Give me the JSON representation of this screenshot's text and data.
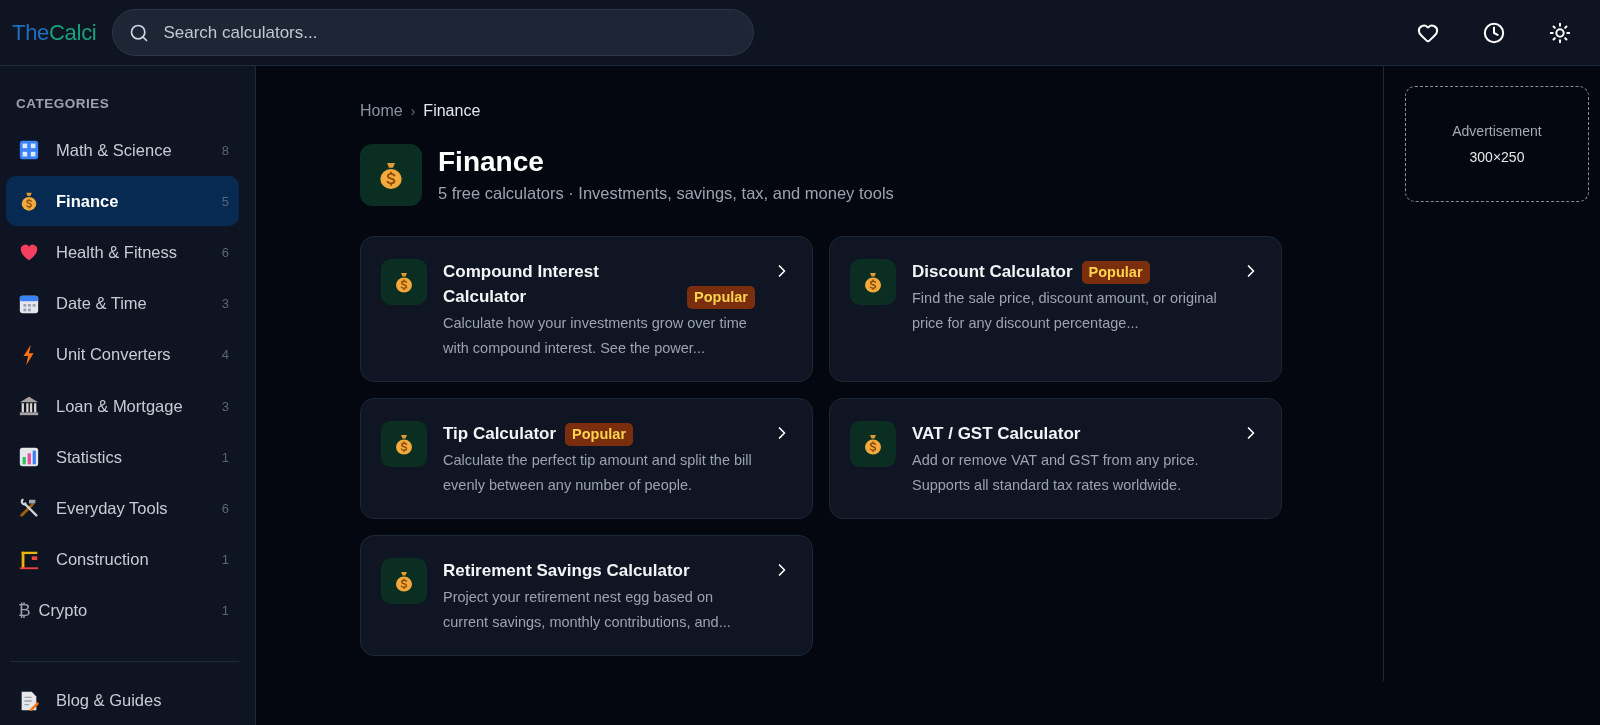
{
  "logo": {
    "first": "The",
    "second": "Calci"
  },
  "search": {
    "placeholder": "Search calculators..."
  },
  "sidebar": {
    "heading": "CATEGORIES",
    "items": [
      {
        "label": "Math & Science",
        "count": "8",
        "selected": false
      },
      {
        "label": "Finance",
        "count": "5",
        "selected": true
      },
      {
        "label": "Health & Fitness",
        "count": "6",
        "selected": false
      },
      {
        "label": "Date & Time",
        "count": "3",
        "selected": false
      },
      {
        "label": "Unit Converters",
        "count": "4",
        "selected": false
      },
      {
        "label": "Loan & Mortgage",
        "count": "3",
        "selected": false
      },
      {
        "label": "Statistics",
        "count": "1",
        "selected": false
      },
      {
        "label": "Everyday Tools",
        "count": "6",
        "selected": false
      },
      {
        "label": "Construction",
        "count": "1",
        "selected": false
      },
      {
        "label": "Crypto",
        "count": "1",
        "symbol": "₿",
        "selected": false
      }
    ],
    "footer_link": {
      "label": "Blog & Guides"
    }
  },
  "breadcrumb": [
    "Home",
    "›",
    "Finance"
  ],
  "page": {
    "title": "Finance",
    "subtitle": "5 free calculators · Investments, savings, tax, and money tools"
  },
  "cards": [
    {
      "title": "Compound Interest Calculator",
      "badge": "Popular",
      "description": "Calculate how your investments grow over time with compound interest. See the power..."
    },
    {
      "title": "Discount Calculator",
      "badge": "Popular",
      "description": "Find the sale price, discount amount, or original price for any discount percentage..."
    },
    {
      "title": "Tip Calculator",
      "badge": "Popular",
      "description": "Calculate the perfect tip amount and split the bill evenly between any number of people."
    },
    {
      "title": "VAT / GST Calculator",
      "description": "Add or remove VAT and GST from any price. Supports all standard tax rates worldwide."
    },
    {
      "title": "Retirement Savings Calculator",
      "description": "Project your retirement nest egg based on current savings, monthly contributions, and..."
    }
  ],
  "ad": {
    "label": "Advertisement",
    "size": "300×250"
  }
}
